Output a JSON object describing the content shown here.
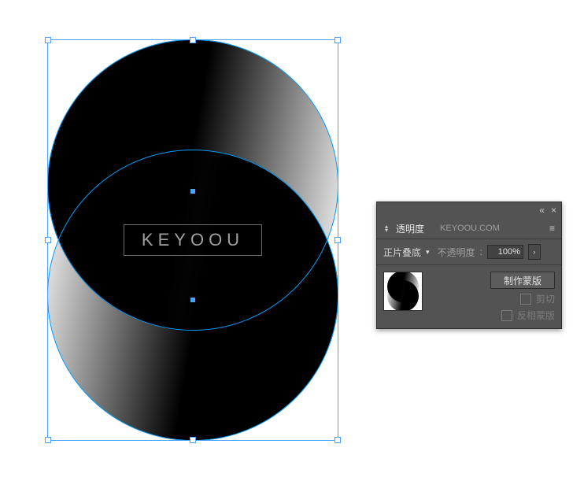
{
  "watermark": "KEYOOU",
  "panel": {
    "tab_active": "透明度",
    "tab_secondary": "KEYOOU.COM",
    "blend_mode": "正片叠底",
    "opacity_label": "不透明度",
    "opacity_value": "100%",
    "make_mask": "制作蒙版",
    "clip": "剪切",
    "invert_mask": "反相蒙版"
  }
}
